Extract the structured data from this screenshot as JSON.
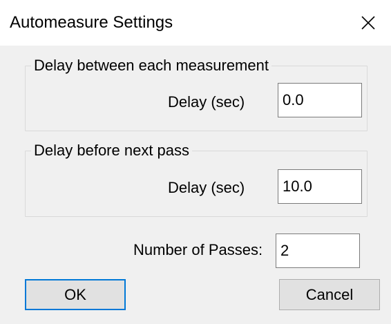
{
  "window": {
    "title": "Automeasure Settings"
  },
  "group_measurement": {
    "label": "Delay between each measurement",
    "delay_label": "Delay (sec)",
    "delay_value": "0.0"
  },
  "group_pass": {
    "label": "Delay before next pass",
    "delay_label": "Delay (sec)",
    "delay_value": "10.0"
  },
  "passes": {
    "label": "Number of Passes:",
    "value": "2"
  },
  "buttons": {
    "ok_label": "OK",
    "cancel_label": "Cancel"
  },
  "colors": {
    "accent": "#0078d7",
    "window_bg": "#f0f0f0",
    "titlebar_bg": "#ffffff"
  },
  "icons": {
    "close": "close-icon"
  }
}
